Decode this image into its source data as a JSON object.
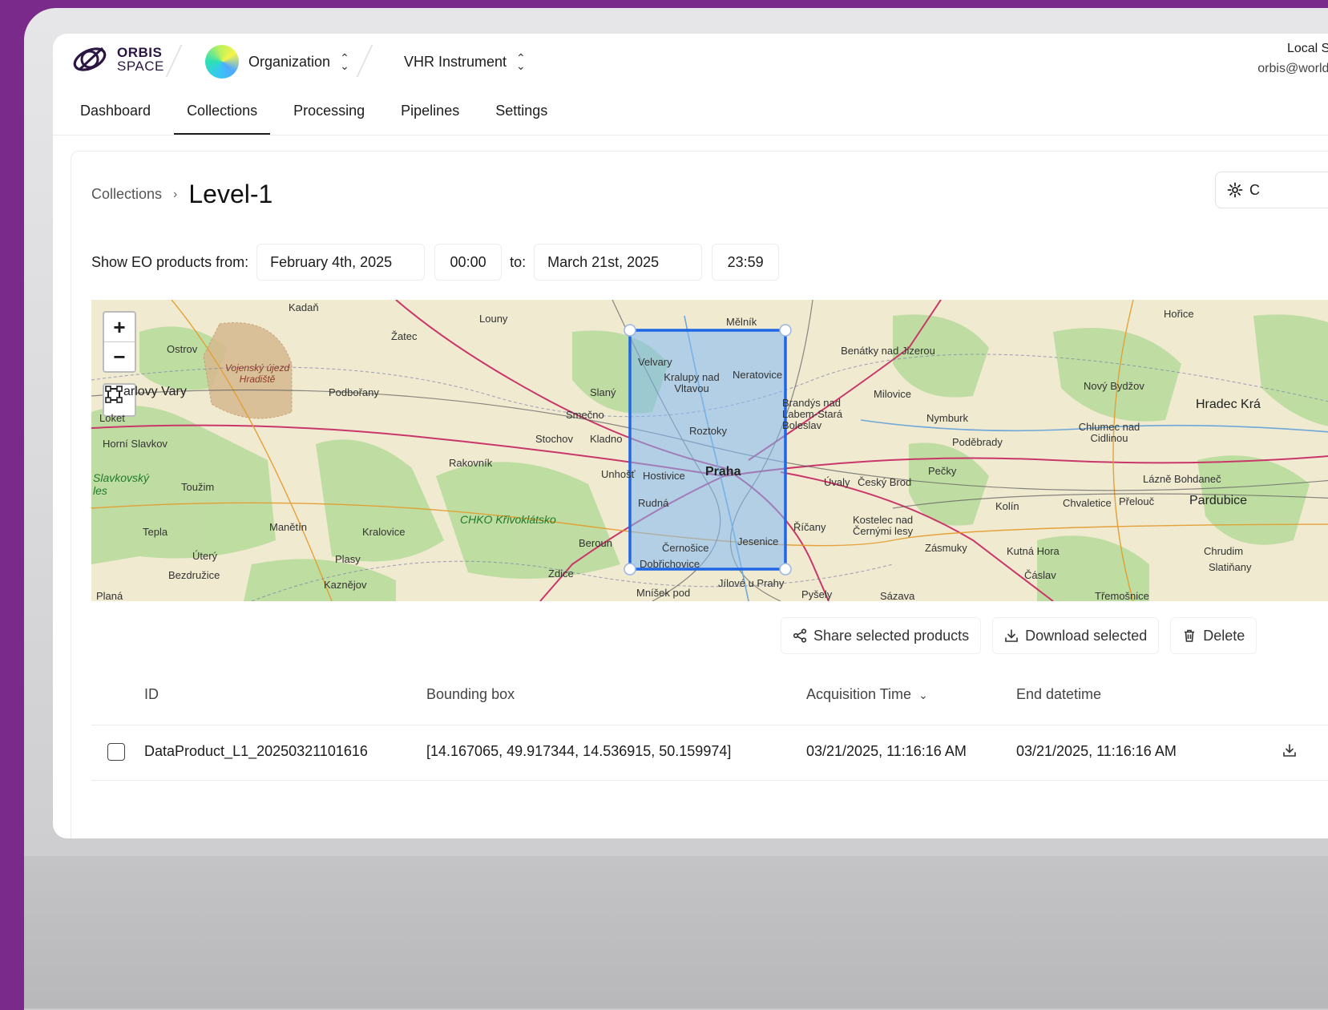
{
  "brand": {
    "line1": "ORBIS",
    "line2": "SPACE"
  },
  "org_switcher": {
    "label": "Organization"
  },
  "instrument_switcher": {
    "label": "VHR Instrument"
  },
  "user": {
    "name": "Local Supe",
    "email": "orbis@worldfron"
  },
  "nav": {
    "tabs": [
      {
        "label": "Dashboard"
      },
      {
        "label": "Collections"
      },
      {
        "label": "Processing"
      },
      {
        "label": "Pipelines"
      },
      {
        "label": "Settings"
      }
    ],
    "active": "Collections"
  },
  "breadcrumb": {
    "parent": "Collections",
    "separator": "›",
    "current": "Level-1"
  },
  "config_button": {
    "label": "C"
  },
  "date_filter": {
    "label": "Show EO products from:",
    "from_date": "February 4th, 2025",
    "from_time": "00:00",
    "to_label": "to:",
    "to_date": "March 21st, 2025",
    "to_time": "23:59"
  },
  "map": {
    "zoom_in": "+",
    "zoom_out": "−",
    "places": [
      "Kadaň",
      "Louny",
      "Mělník",
      "Hořice",
      "Žatec",
      "Ostrov",
      "Vojenský újezd Hradiště",
      "arlovy Vary",
      "Podbořany",
      "Slaný",
      "Velvary",
      "Kralupy nad Vltavou",
      "Neratovice",
      "Benátky nad Jizerou",
      "Milovice",
      "Nový Bydžov",
      "Hradec Krá",
      "Smečno",
      "Stochov",
      "Kladno",
      "Roztoky",
      "Brandýs nad Labem-Stará Boleslav",
      "Nymburk",
      "Poděbrady",
      "Chlumec nad Cidlinou",
      "Horní Slavkov",
      "Rakovník",
      "Unhošť",
      "Hostivice",
      "Praha",
      "Úvaly",
      "Český Brod",
      "Pečky",
      "Lázně Bohdaneč",
      "Slavkovský les",
      "Toužim",
      "CHKO Křivoklátsko",
      "Rudná",
      "Kolín",
      "Chvaletice",
      "Přelouč",
      "Pardubice",
      "Manětín",
      "Kralovice",
      "Beroun",
      "Říčany",
      "Kostelec nad Černými lesy",
      "Tepla",
      "Černošice",
      "Jesenice",
      "Zásmuky",
      "Kutná Hora",
      "Chrudim",
      "Úterý",
      "Plasy",
      "Dobřichovice",
      "Bezdružice",
      "Kaznějov",
      "Zdice",
      "Mníšek pod",
      "Jílové u Prahy",
      "Pyšely",
      "Sázava",
      "Čáslav",
      "Slatiňany",
      "Třemošnice",
      "Planá",
      "Loket"
    ],
    "colors": {
      "selection": "#1f66e5",
      "selection_fill": "#7fb8f5"
    }
  },
  "actions": {
    "share": "Share selected products",
    "download": "Download selected",
    "delete": "Delete"
  },
  "table": {
    "columns": [
      "ID",
      "Bounding box",
      "Acquisition Time",
      "End datetime"
    ],
    "rows": [
      {
        "id": "DataProduct_L1_20250321101616",
        "bbox": "[14.167065, 49.917344, 14.536915, 50.159974]",
        "acquisition": "03/21/2025, 11:16:16 AM",
        "end": "03/21/2025, 11:16:16 AM"
      }
    ]
  }
}
